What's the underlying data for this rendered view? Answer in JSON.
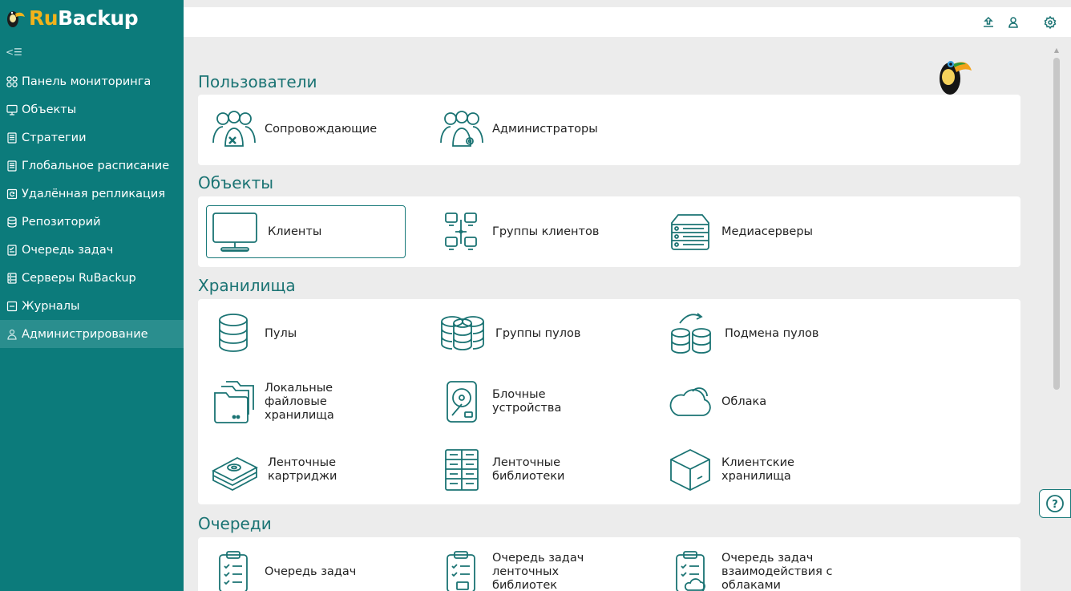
{
  "app": {
    "logo_ru": "Ru",
    "logo_backup": "Backup",
    "collapse_glyph": "<☰"
  },
  "sidebar": {
    "items": [
      {
        "label": "Панель мониторинга",
        "icon": "dashboard-icon"
      },
      {
        "label": "Объекты",
        "icon": "monitor-icon"
      },
      {
        "label": "Стратегии",
        "icon": "document-icon"
      },
      {
        "label": "Глобальное расписание",
        "icon": "document-icon"
      },
      {
        "label": "Удалённая репликация",
        "icon": "replication-icon"
      },
      {
        "label": "Репозиторий",
        "icon": "database-icon"
      },
      {
        "label": "Очередь задач",
        "icon": "checklist-icon"
      },
      {
        "label": "Серверы RuBackup",
        "icon": "server-icon"
      },
      {
        "label": "Журналы",
        "icon": "log-icon"
      },
      {
        "label": "Администрирование",
        "icon": "admin-icon",
        "active": true
      }
    ]
  },
  "topbar": {
    "icons": [
      "upload-icon",
      "user-icon",
      "settings-icon"
    ]
  },
  "sections": {
    "users": {
      "title": "Пользователи",
      "tiles": [
        {
          "label": "Сопровождающие",
          "icon": "maintainers-icon"
        },
        {
          "label": "Администраторы",
          "icon": "administrators-icon"
        }
      ]
    },
    "objects": {
      "title": "Объекты",
      "tiles": [
        {
          "label": "Клиенты",
          "icon": "client-monitor-icon",
          "selected": true
        },
        {
          "label": "Группы клиентов",
          "icon": "client-groups-icon"
        },
        {
          "label": "Медиасерверы",
          "icon": "media-servers-icon"
        }
      ]
    },
    "storage": {
      "title": "Хранилища",
      "tiles": [
        {
          "label": "Пулы",
          "icon": "pool-icon"
        },
        {
          "label": "Группы пулов",
          "icon": "pool-groups-icon"
        },
        {
          "label": "Подмена пулов",
          "icon": "pool-swap-icon"
        },
        {
          "label": "Локальные\nфайловые\nхранилища",
          "icon": "local-folders-icon"
        },
        {
          "label": "Блочные\nустройства",
          "icon": "hard-disk-icon"
        },
        {
          "label": "Облака",
          "icon": "cloud-icon"
        },
        {
          "label": "Ленточные\nкартриджи",
          "icon": "tape-cartridges-icon"
        },
        {
          "label": "Ленточные\nбиблиотеки",
          "icon": "tape-library-icon"
        },
        {
          "label": "Клиентские\nхранилища",
          "icon": "box-icon"
        }
      ]
    },
    "queues": {
      "title": "Очереди",
      "tiles": [
        {
          "label": "Очередь задач",
          "icon": "task-queue-icon"
        },
        {
          "label": "Очередь задач\nленточных\nбиблиотек",
          "icon": "tape-queue-icon"
        },
        {
          "label": "Очередь задач\nвзаимодействия с\nоблаками",
          "icon": "cloud-queue-icon"
        }
      ]
    }
  },
  "help": {
    "label": "?"
  },
  "colors": {
    "sidebar": "#0c7b7b",
    "accent": "#1a7373",
    "logo_ru": "#f2b31b",
    "active_item": "#2a8e8e"
  }
}
